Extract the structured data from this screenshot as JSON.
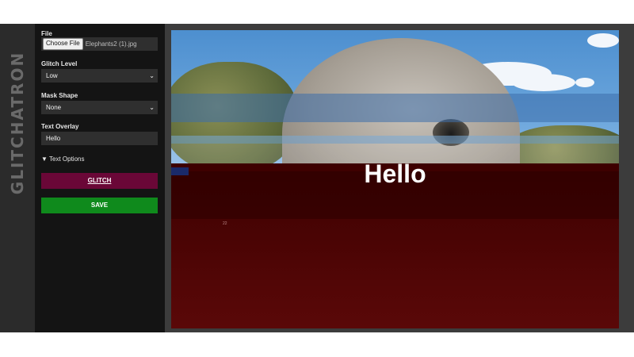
{
  "brand": {
    "title": "GLITCHATRON"
  },
  "controls": {
    "file": {
      "label": "File",
      "button": "Choose File",
      "filename": "Elephants2 (1).jpg"
    },
    "glitch_level": {
      "label": "Glitch Level",
      "value": "Low"
    },
    "mask_shape": {
      "label": "Mask Shape",
      "value": "None"
    },
    "text_overlay": {
      "label": "Text Overlay",
      "value": "Hello"
    },
    "text_options": {
      "label": "▼ Text Options"
    },
    "glitch_button": {
      "label": "GLITCH"
    },
    "save_button": {
      "label": "SAVE"
    }
  },
  "canvas": {
    "overlay_text": "Hello",
    "small_label": "22"
  },
  "colors": {
    "glitch_button": "#6a0737",
    "save_button": "#0f8a1c",
    "panel": "#141414"
  }
}
